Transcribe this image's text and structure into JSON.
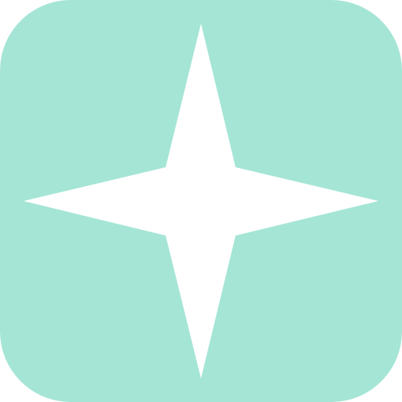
{
  "app_icon": {
    "icon": "sparkle-star-icon",
    "colors": {
      "background": "#a5e5d6",
      "glyph": "#ffffff"
    }
  }
}
